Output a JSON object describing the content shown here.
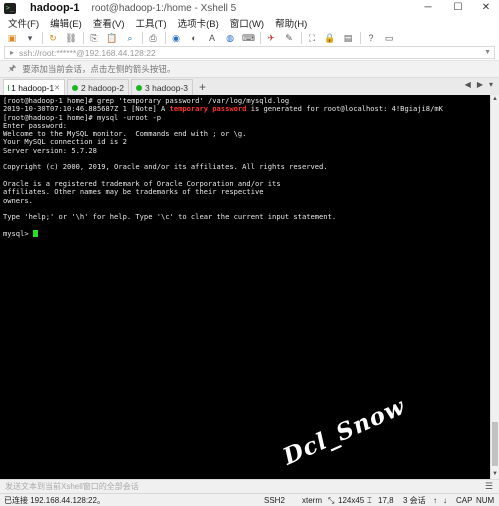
{
  "window": {
    "title": "hadoop-1",
    "subtitle": "root@hadoop-1:/home - Xshell 5",
    "minimize": "─",
    "maximize": "☐",
    "close": "✕"
  },
  "menu": [
    "文件(F)",
    "编辑(E)",
    "查看(V)",
    "工具(T)",
    "选项卡(B)",
    "窗口(W)",
    "帮助(H)"
  ],
  "address": {
    "value": "ssh://root:******@192.168.44.128:22"
  },
  "infobar": {
    "text": "要添加当前会话，点击左侧的箭头按钮。"
  },
  "tabs": [
    {
      "label": "1 hadoop-1",
      "active": true,
      "status": "green"
    },
    {
      "label": "2 hadoop-2",
      "active": false,
      "status": "green"
    },
    {
      "label": "3 hadoop-3",
      "active": false,
      "status": "green"
    }
  ],
  "terminal": {
    "lines": [
      {
        "text": "[root@hadoop-1 home]# grep 'temporary password' /var/log/mysqld.log"
      },
      {
        "pre": "2019-10-30T07:10:46.885687Z 1 [Note] A ",
        "hl": "temporary password",
        "post": " is generated for root@localhost: 4!Bgiaji8/mK"
      },
      {
        "text": "[root@hadoop-1 home]# mysql -uroot -p"
      },
      {
        "text": "Enter password:"
      },
      {
        "text": "Welcome to the MySQL monitor.  Commands end with ; or \\g."
      },
      {
        "text": "Your MySQL connection id is 2"
      },
      {
        "text": "Server version: 5.7.28"
      },
      {
        "text": ""
      },
      {
        "text": "Copyright (c) 2000, 2019, Oracle and/or its affiliates. All rights reserved."
      },
      {
        "text": ""
      },
      {
        "text": "Oracle is a registered trademark of Oracle Corporation and/or its"
      },
      {
        "text": "affiliates. Other names may be trademarks of their respective"
      },
      {
        "text": "owners."
      },
      {
        "text": ""
      },
      {
        "text": "Type 'help;' or '\\h' for help. Type '\\c' to clear the current input statement."
      },
      {
        "text": ""
      },
      {
        "text": "mysql> "
      }
    ],
    "watermark": "Dcl_Snow",
    "highlight_color": "#ff3030",
    "cursor_color": "#21e321"
  },
  "sendbar": {
    "placeholder": "发送文本到当前Xshell窗口的全部会话"
  },
  "status": {
    "connection": "已连接 192.168.44.128:22。",
    "protocol": "SSH2",
    "terminal_type": "xterm",
    "size": "124x45",
    "position": "17,8",
    "sessions": "3 会话",
    "caps": "CAP",
    "num": "NUM"
  }
}
